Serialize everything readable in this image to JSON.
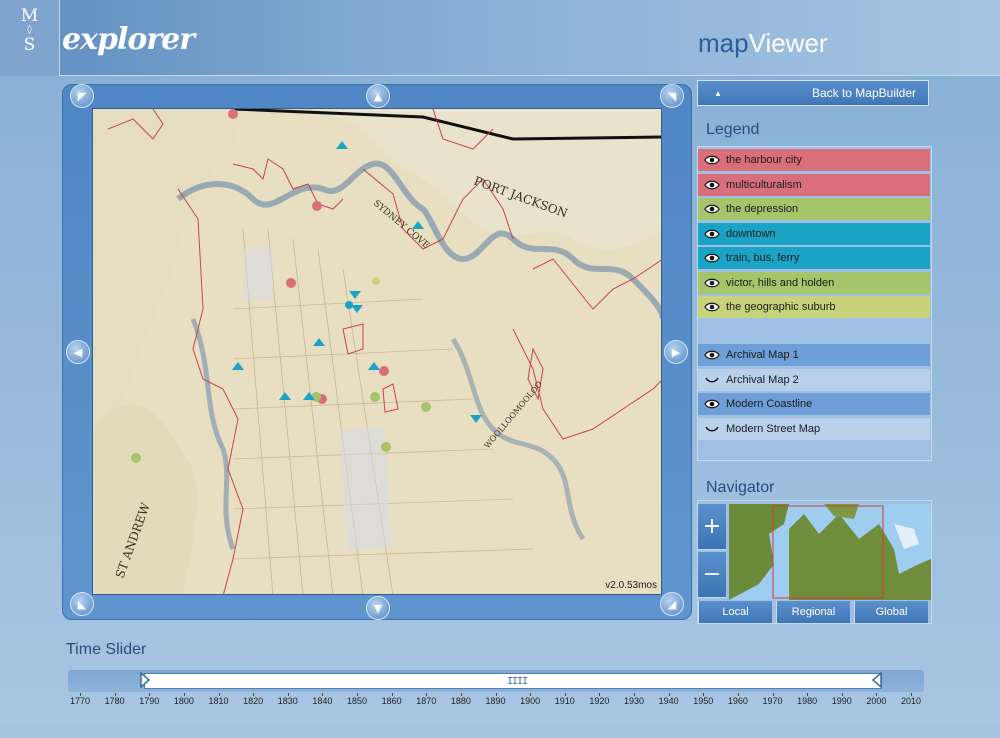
{
  "header": {
    "logo_top": "M",
    "logo_bottom": "S",
    "brand": "explorer",
    "title_light": "map",
    "title_bold": "Viewer"
  },
  "map": {
    "version": "v2.0.53mos"
  },
  "panel": {
    "back_label": "Back to MapBuilder",
    "legend_title": "Legend",
    "navigator_title": "Navigator"
  },
  "legend": {
    "themes": [
      {
        "label": "the harbour city",
        "color": "#d86f7a",
        "visible": true
      },
      {
        "label": "multiculturalism",
        "color": "#d86f7a",
        "visible": true
      },
      {
        "label": "the depression",
        "color": "#a6c46a",
        "visible": true
      },
      {
        "label": "downtown",
        "color": "#1aa3c4",
        "visible": true
      },
      {
        "label": "train, bus, ferry",
        "color": "#1aa3c4",
        "visible": true
      },
      {
        "label": "victor, hills and holden",
        "color": "#a6c46a",
        "visible": true
      },
      {
        "label": "the geographic suburb",
        "color": "#c7d27a",
        "visible": true
      }
    ],
    "layers": [
      {
        "label": "Archival Map 1",
        "visible": true
      },
      {
        "label": "Archival Map 2",
        "visible": false
      },
      {
        "label": "Modern Coastline",
        "visible": true
      },
      {
        "label": "Modern Street Map",
        "visible": false
      }
    ]
  },
  "navigator": {
    "zoom_in": "+",
    "zoom_out": "−",
    "tabs": [
      "Local",
      "Regional",
      "Global"
    ]
  },
  "time_slider": {
    "title": "Time Slider",
    "years": [
      "1770",
      "1780",
      "1790",
      "1800",
      "1810",
      "1820",
      "1830",
      "1840",
      "1850",
      "1860",
      "1870",
      "1880",
      "1890",
      "1900",
      "1910",
      "1920",
      "1930",
      "1940",
      "1950",
      "1960",
      "1970",
      "1980",
      "1990",
      "2000",
      "2010"
    ],
    "range_start": "1788",
    "range_end": "2000",
    "grip": "IIII"
  },
  "colors": {
    "accent": "#3f76b6",
    "theme_red": "#d86f7a",
    "theme_green": "#a6c46a",
    "theme_teal": "#1aa3c4"
  }
}
